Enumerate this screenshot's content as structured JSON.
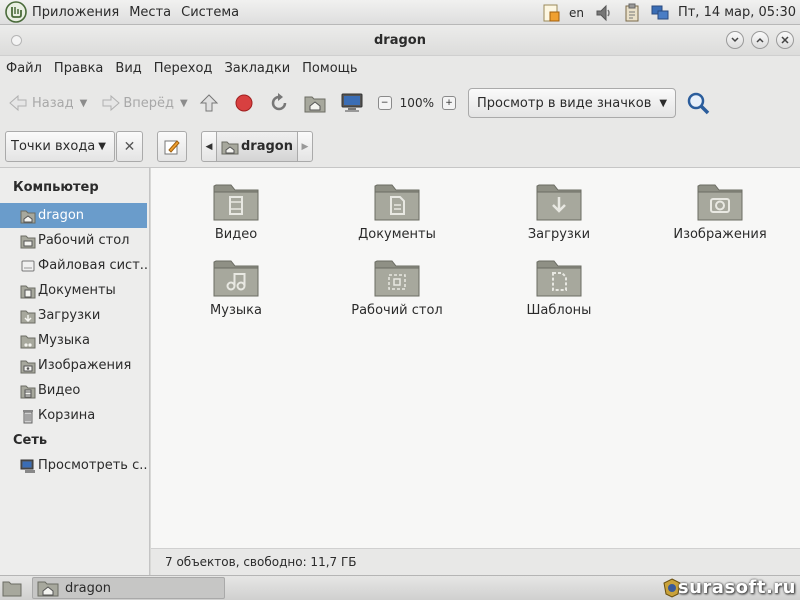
{
  "panel": {
    "menu": [
      "Приложения",
      "Места",
      "Система"
    ],
    "lang": "en",
    "clock": "Пт, 14 мар, 05:30"
  },
  "window": {
    "title": "dragon"
  },
  "menubar": [
    "Файл",
    "Правка",
    "Вид",
    "Переход",
    "Закладки",
    "Помощь"
  ],
  "toolbar": {
    "back_label": "Назад",
    "forward_label": "Вперёд",
    "zoom": "100%",
    "view_mode": "Просмотр в виде значков"
  },
  "location": {
    "places_label": "Точки входа",
    "crumb": "dragon"
  },
  "sidebar": {
    "computer_heading": "Компьютер",
    "items": [
      {
        "label": "dragon",
        "icon": "home-folder-icon"
      },
      {
        "label": "Рабочий стол",
        "icon": "desktop-folder-icon"
      },
      {
        "label": "Файловая сист...",
        "icon": "filesystem-icon"
      },
      {
        "label": "Документы",
        "icon": "documents-folder-icon"
      },
      {
        "label": "Загрузки",
        "icon": "downloads-folder-icon"
      },
      {
        "label": "Музыка",
        "icon": "music-folder-icon"
      },
      {
        "label": "Изображения",
        "icon": "pictures-folder-icon"
      },
      {
        "label": "Видео",
        "icon": "videos-folder-icon"
      },
      {
        "label": "Корзина",
        "icon": "trash-icon"
      }
    ],
    "network_heading": "Сеть",
    "network_items": [
      {
        "label": "Просмотреть с...",
        "icon": "network-icon"
      }
    ]
  },
  "files": [
    {
      "name": "Видео",
      "icon": "video-folder-icon"
    },
    {
      "name": "Документы",
      "icon": "documents-folder-icon"
    },
    {
      "name": "Загрузки",
      "icon": "downloads-folder-icon"
    },
    {
      "name": "Изображения",
      "icon": "pictures-folder-icon"
    },
    {
      "name": "Музыка",
      "icon": "music-folder-icon"
    },
    {
      "name": "Рабочий стол",
      "icon": "desktop-folder-icon"
    },
    {
      "name": "Шаблоны",
      "icon": "templates-folder-icon"
    }
  ],
  "status": "7 объектов, свободно: 11,7 ГБ",
  "taskbar": {
    "window_label": "dragon"
  },
  "watermark": "surasoft.ru",
  "colors": {
    "selection": "#6a9ccb",
    "folder": "#a7a89d"
  }
}
